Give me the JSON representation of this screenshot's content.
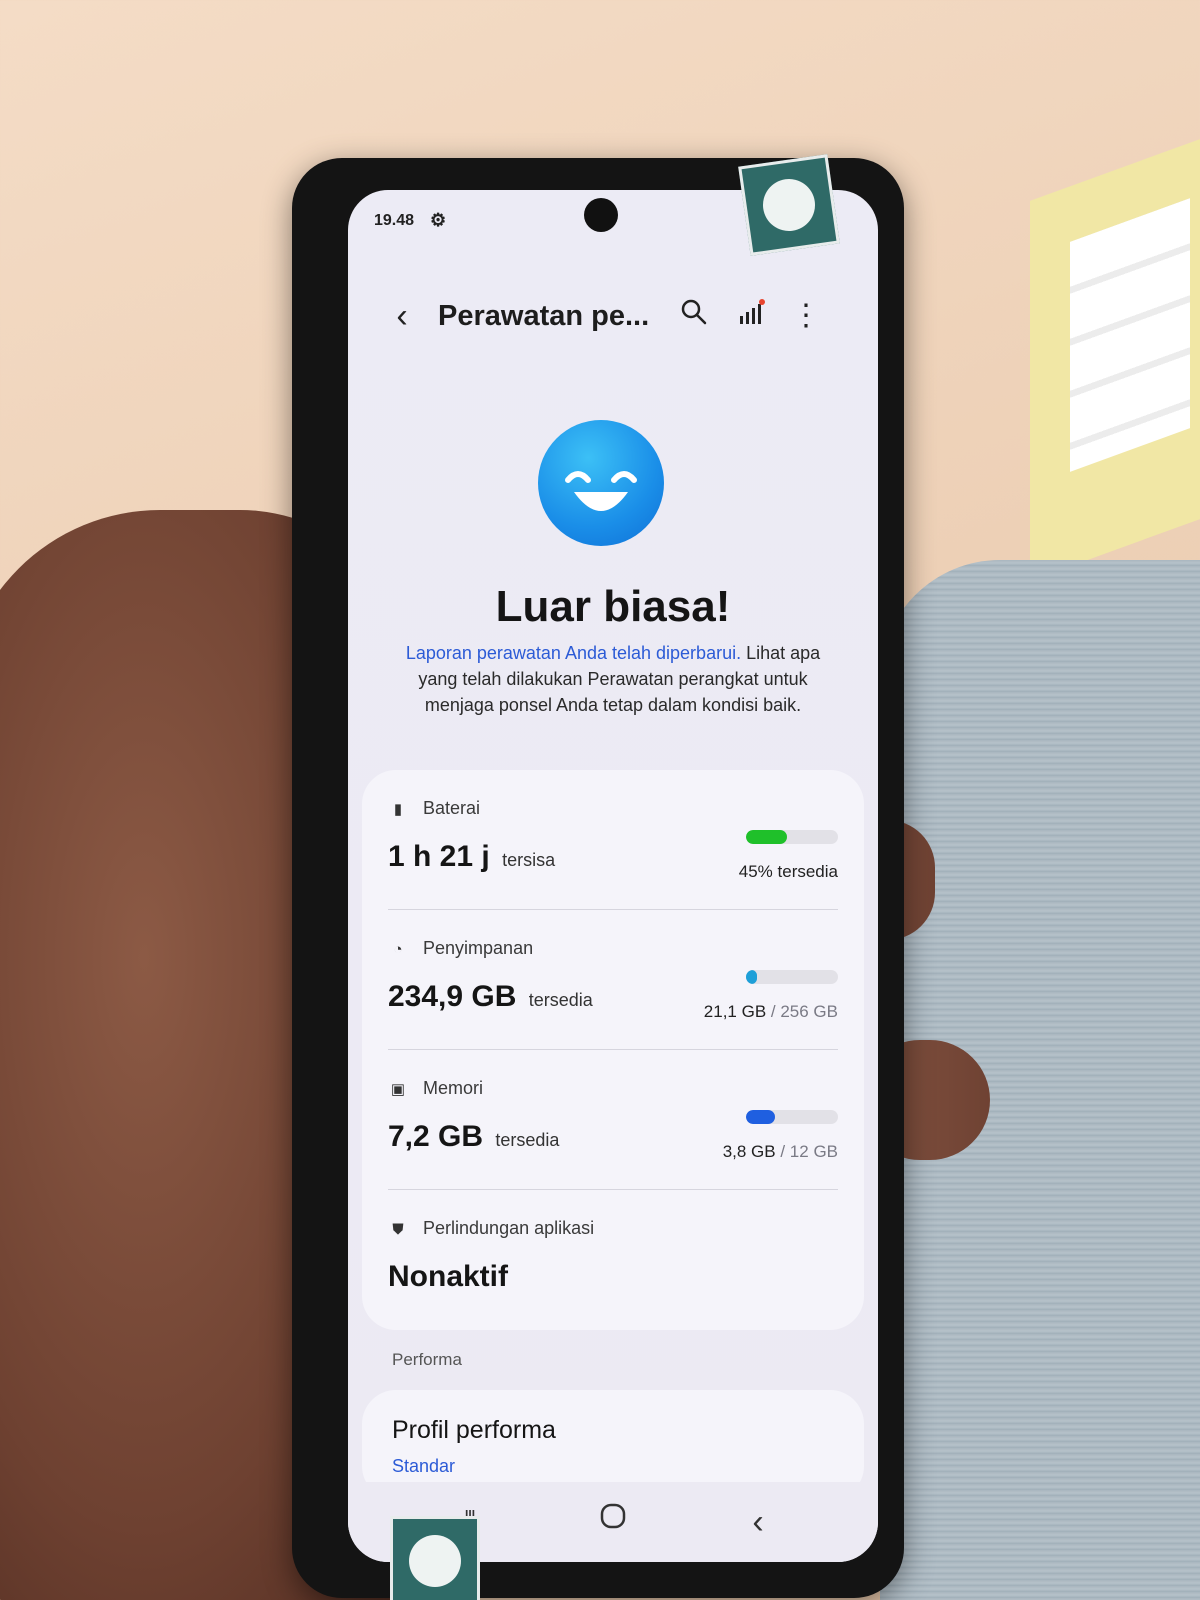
{
  "status_bar": {
    "time": "19.48",
    "gear_icon": "gear-icon"
  },
  "toolbar": {
    "back_icon": "chevron-left-icon",
    "title": "Perawatan pe...",
    "search_icon": "search-icon",
    "signal_icon": "signal-bars-icon",
    "more_icon": "more-vertical-icon"
  },
  "hero": {
    "emoji_icon": "smiley-face-icon",
    "heading": "Luar biasa!",
    "description_link": "Laporan perawatan Anda telah diperbarui.",
    "description_rest": "Lihat apa yang telah dilakukan Perawatan perangkat untuk menjaga ponsel Anda tetap dalam kondisi baik."
  },
  "status_card": {
    "battery": {
      "icon": "battery-icon",
      "label": "Baterai",
      "value": "1 h 21 j",
      "suffix": "tersisa",
      "right_text": "45% tersedia",
      "level": 0.45,
      "color": "#1fc02a"
    },
    "storage": {
      "icon": "pie-chart-icon",
      "label": "Penyimpanan",
      "value": "234,9 GB",
      "suffix": "tersedia",
      "used": "21,1 GB",
      "total": "/ 256 GB",
      "level": 0.08,
      "color": "#1e9fd8"
    },
    "memory": {
      "icon": "memory-chip-icon",
      "label": "Memori",
      "value": "7,2 GB",
      "suffix": "tersedia",
      "used": "3,8 GB",
      "total": "/ 12 GB",
      "level": 0.32,
      "color": "#1f5fe0"
    },
    "app_protection": {
      "icon": "shield-icon",
      "label": "Perlindungan aplikasi",
      "value": "Nonaktif"
    }
  },
  "performance": {
    "section_label": "Performa",
    "title": "Profil performa",
    "subtitle": "Standar"
  },
  "nav": {
    "recent_icon": "recent-apps-icon",
    "home_icon": "home-icon",
    "back_icon": "back-icon"
  }
}
